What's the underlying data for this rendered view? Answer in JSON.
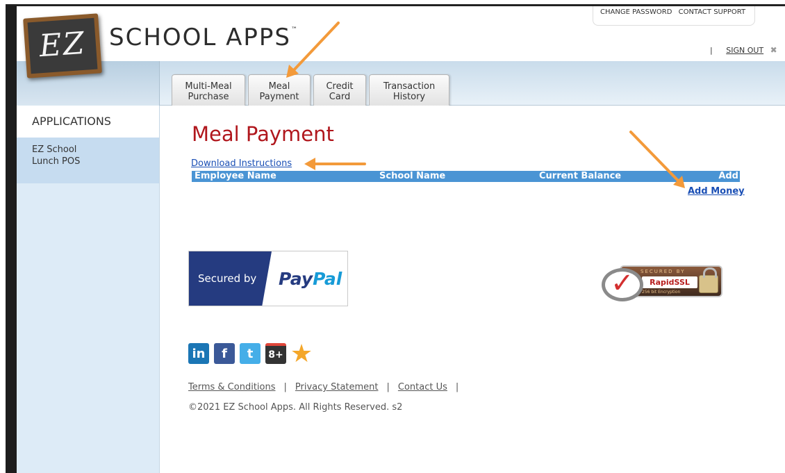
{
  "header": {
    "logo_text": "EZ",
    "brand": "SCHOOL APPS",
    "tm": "™",
    "change_password": "CHANGE PASSWORD",
    "contact_support": "CONTACT SUPPORT",
    "separator": "|",
    "sign_out": "SIGN OUT",
    "sign_out_icon": "✖"
  },
  "tabs": [
    {
      "line1": "Multi-Meal",
      "line2": "Purchase"
    },
    {
      "line1": "Meal",
      "line2": "Payment"
    },
    {
      "line1": "Credit",
      "line2": "Card"
    },
    {
      "line1": "Transaction",
      "line2": "History"
    }
  ],
  "sidebar": {
    "title": "APPLICATIONS",
    "items": [
      {
        "line1": "EZ School",
        "line2": "Lunch POS"
      }
    ]
  },
  "main": {
    "title": "Meal Payment",
    "download_link": "Download Instructions",
    "table": {
      "headers": [
        "Employee Name",
        "School Name",
        "Current Balance",
        "Add Money"
      ],
      "add_money_link": "Add Money"
    }
  },
  "badges": {
    "paypal_secured": "Secured by",
    "paypal_pay": "Pay",
    "paypal_pal": "Pal",
    "ssl_top": "SECURED BY",
    "ssl_name": "RapidSSL",
    "ssl_sub": "256 bit Encryption"
  },
  "social": {
    "linkedin": "in",
    "facebook": "f",
    "twitter": "t",
    "googleplus": "8+",
    "star": "★"
  },
  "footer": {
    "terms": "Terms & Conditions",
    "privacy": "Privacy Statement",
    "contact": "Contact Us",
    "sep": "|",
    "copyright": "©2021 EZ School Apps. All Rights Reserved. s2"
  },
  "colors": {
    "title_red": "#b0161c",
    "link_blue": "#1a4fb5",
    "table_header": "#4a94d4",
    "arrow_orange": "#f39a3a"
  }
}
